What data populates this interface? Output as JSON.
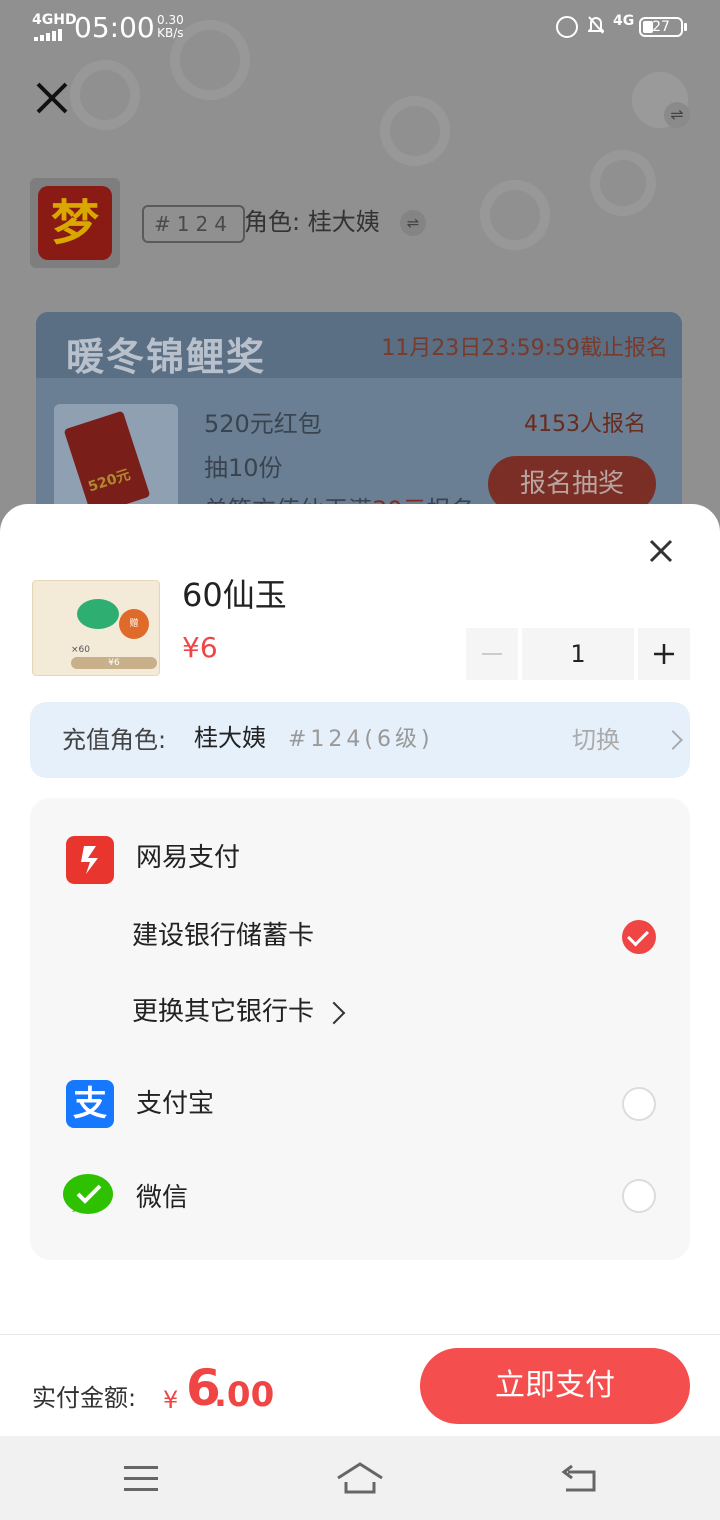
{
  "status_bar": {
    "network": "4GHD",
    "time": "05:00",
    "speed_value": "0.30",
    "speed_unit": "KB/s",
    "net_type_right": "4G",
    "battery": "27"
  },
  "game": {
    "logo_char": "梦",
    "server_tag": "#124",
    "role_line": "角色: 桂大姨",
    "switch_icon": "⇌"
  },
  "banner": {
    "title": "暖冬锦鲤奖",
    "deadline": "11月23日23:59:59截止报名",
    "prize": "520元红包",
    "draw": "抽10份",
    "condition": "单笔充值仙玉满",
    "condition_tail": "报名",
    "signups": "4153人报名",
    "button": "报名抽奖",
    "envelope_text": "520元"
  },
  "product": {
    "name": "60仙玉",
    "price": "¥6",
    "quantity": "1",
    "image_caption": "×60",
    "image_badge": "赠",
    "image_price": "¥6"
  },
  "recharge_role": {
    "label": "充值角色:",
    "name": "桂大姨",
    "server": "#124(6级)",
    "switch_label": "切换"
  },
  "payment": {
    "netease": {
      "label": "网易支付"
    },
    "bank_card": {
      "label": "建设银行储蓄卡",
      "selected": true
    },
    "change_card": {
      "label": "更换其它银行卡"
    },
    "alipay": {
      "label": "支付宝",
      "glyph": "支",
      "selected": false
    },
    "wechat": {
      "label": "微信",
      "selected": false
    }
  },
  "footer": {
    "total_label": "实付金额:",
    "currency": "¥",
    "amount_int": "6",
    "amount_dec": ".00",
    "pay_button": "立即支付"
  },
  "colors": {
    "accent": "#f04545",
    "role_bar": "#e6f0fb",
    "alipay": "#1677ff",
    "wechat": "#2dc100"
  }
}
